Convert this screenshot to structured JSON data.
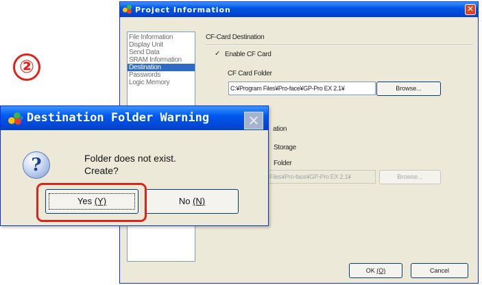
{
  "step_badge": "②",
  "project_window": {
    "title": "Project Information",
    "close_glyph": "✕",
    "nav_items": [
      "File Information",
      "Display Unit",
      "Send Data",
      "SRAM Information",
      "Destination",
      "Passwords",
      "Logic Memory"
    ],
    "selected_item": "Destination",
    "cf_section_label": "CF-Card Destination",
    "enable_cf_label": "Enable CF Card",
    "enable_cf_checked": true,
    "cf_folder_label": "CF Card Folder",
    "cf_folder_value": "C:¥Program Files¥Pro-face¥GP-Pro EX 2.1¥",
    "browse_label": "Browse...",
    "section2_label_partial": "ation",
    "storage_label_partial": "Storage",
    "folder2_label_partial": "Folder",
    "folder2_value": "Files¥Pro-face¥GP-Pro EX 2.1¥",
    "browse2_label": "Browse...",
    "ok_label": "OK",
    "ok_mnemonic": "(O)",
    "cancel_label": "Cancel"
  },
  "warning_dialog": {
    "title": "Destination Folder Warning",
    "close_glyph": "✕",
    "icon": "question-icon",
    "icon_glyph": "?",
    "message_line1": "Folder does not exist.",
    "message_line2": "Create?",
    "yes_label": "Yes ",
    "yes_mnemonic": "(Y)",
    "no_label": "No ",
    "no_mnemonic": "(N)"
  },
  "colors": {
    "title_blue": "#0055e5",
    "highlight_red": "#e0201a",
    "selected_bg": "#316ac5"
  }
}
